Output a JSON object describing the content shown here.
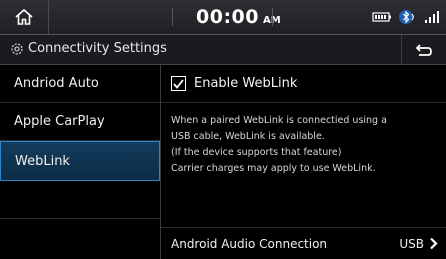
{
  "status": {
    "time": "00:00",
    "ampm": "AM"
  },
  "header": {
    "title": "Connectivity Settings"
  },
  "sidebar": {
    "items": [
      {
        "label": "Andriod Auto"
      },
      {
        "label": "Apple CarPlay"
      },
      {
        "label": "WebLink",
        "selected": true
      }
    ]
  },
  "content": {
    "enable": {
      "label": "Enable WebLink",
      "checked": true
    },
    "description": [
      "When a paired WebLink is connectied using a",
      "USB cable, WebLink is available.",
      "(If the device supports that feature)",
      "Carrier charges may apply to use WebLink."
    ],
    "audio": {
      "label": "Android Audio Connection",
      "value": "USB"
    }
  },
  "colors": {
    "accent": "#2f86c4",
    "selected_bg": "#123c5c",
    "background": "#000000"
  },
  "icons": [
    "home-icon",
    "battery-icon",
    "bluetooth-icon",
    "signal-icon",
    "settings-icon",
    "back-icon",
    "check-icon",
    "chevron-right-icon"
  ]
}
